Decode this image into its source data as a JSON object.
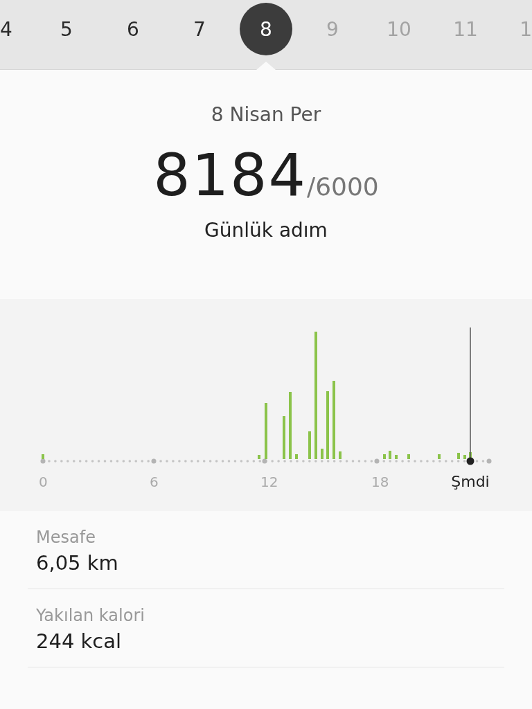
{
  "days": [
    {
      "label": "4",
      "selected": false,
      "disabled": false
    },
    {
      "label": "5",
      "selected": false,
      "disabled": false
    },
    {
      "label": "6",
      "selected": false,
      "disabled": false
    },
    {
      "label": "7",
      "selected": false,
      "disabled": false
    },
    {
      "label": "8",
      "selected": true,
      "disabled": false
    },
    {
      "label": "9",
      "selected": false,
      "disabled": true
    },
    {
      "label": "10",
      "selected": false,
      "disabled": true
    },
    {
      "label": "11",
      "selected": false,
      "disabled": true
    },
    {
      "label": "1",
      "selected": false,
      "disabled": true
    }
  ],
  "summary": {
    "date": "8 Nisan Per",
    "steps": "8184",
    "goal": "/6000",
    "caption": "Günlük adım"
  },
  "chart": {
    "x_labels": [
      {
        "label": "0",
        "kind": "tick"
      },
      {
        "label": "6",
        "kind": "tick"
      },
      {
        "label": "12",
        "kind": "tick"
      },
      {
        "label": "18",
        "kind": "tick"
      },
      {
        "label": "Şmdi",
        "kind": "now"
      }
    ]
  },
  "stats": [
    {
      "label": "Mesafe",
      "value": "6,05 km"
    },
    {
      "label": "Yakılan kalori",
      "value": "244 kcal"
    }
  ]
}
